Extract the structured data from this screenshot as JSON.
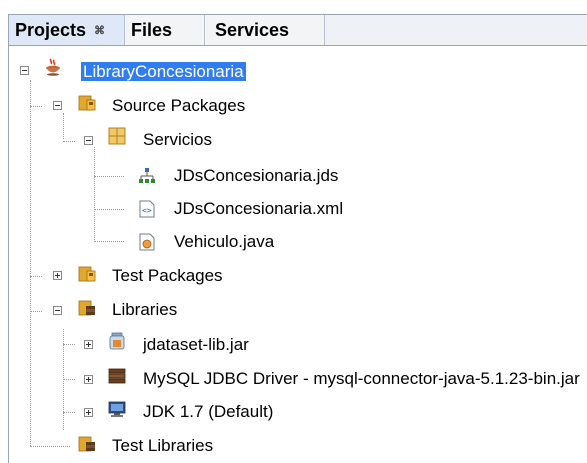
{
  "tabs": [
    {
      "label": "Projects",
      "close": "⌘"
    },
    {
      "label": "Files"
    },
    {
      "label": "Services"
    }
  ],
  "tree": {
    "project": "LibraryConcesionaria",
    "source_packages": "Source Packages",
    "servicios": "Servicios",
    "files": [
      "JDsConcesionaria.jds",
      "JDsConcesionaria.xml",
      "Vehiculo.java"
    ],
    "test_packages": "Test Packages",
    "libraries": "Libraries",
    "library_items": [
      "jdataset-lib.jar",
      "MySQL JDBC Driver - mysql-connector-java-5.1.23-bin.jar",
      "JDK 1.7 (Default)"
    ],
    "test_libraries": "Test Libraries"
  },
  "icons": [
    "coffee-cup-icon",
    "package-folder-icon",
    "package-icon",
    "jds-icon",
    "xml-file-icon",
    "java-class-icon",
    "jar-icon",
    "database-driver-icon",
    "jdk-monitor-icon",
    "library-folder-icon"
  ],
  "colors": {
    "selection": "#2f7df0",
    "tab_active": "#dfe8f6"
  }
}
